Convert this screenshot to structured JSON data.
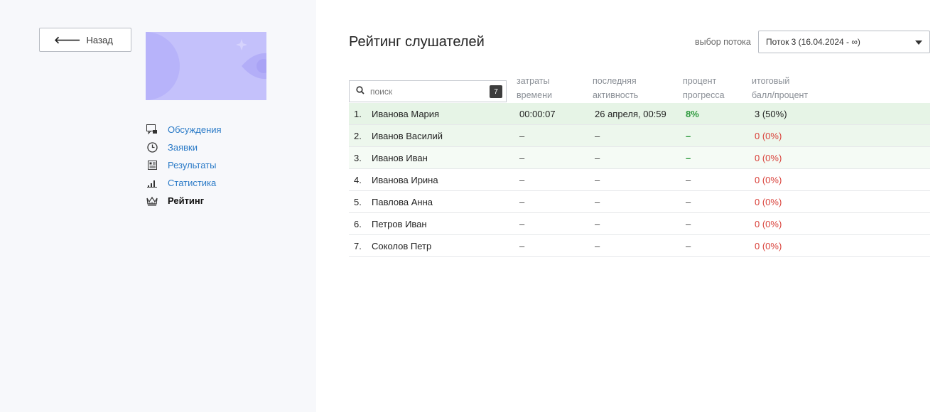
{
  "nav": {
    "back_label": "Назад",
    "items": [
      {
        "label": "Обсуждения",
        "icon": "chat-icon",
        "active": false
      },
      {
        "label": "Заявки",
        "icon": "clock-icon",
        "active": false
      },
      {
        "label": "Результаты",
        "icon": "results-icon",
        "active": false
      },
      {
        "label": "Статистика",
        "icon": "bar-chart-icon",
        "active": false
      },
      {
        "label": "Рейтинг",
        "icon": "crown-icon",
        "active": true
      }
    ]
  },
  "header": {
    "title": "Рейтинг слушателей",
    "stream_label": "выбор потока",
    "stream_selected": "Поток 3 (16.04.2024 - ∞)"
  },
  "search": {
    "placeholder": "поиск",
    "count": "7"
  },
  "columns": {
    "time": [
      "затраты",
      "времени"
    ],
    "activity": [
      "последняя",
      "активность"
    ],
    "progress": [
      "процент",
      "прогресса"
    ],
    "score": [
      "итоговый",
      "балл/процент"
    ]
  },
  "rows": [
    {
      "num": "1.",
      "name": "Иванова Мария",
      "time": "00:00:07",
      "activity": "26 апреля, 00:59",
      "progress": "8%",
      "score": "3 (50%)"
    },
    {
      "num": "2.",
      "name": "Иванов Василий",
      "time": "–",
      "activity": "–",
      "progress": "–",
      "score": "0 (0%)"
    },
    {
      "num": "3.",
      "name": "Иванов Иван",
      "time": "–",
      "activity": "–",
      "progress": "–",
      "score": "0 (0%)"
    },
    {
      "num": "4.",
      "name": "Иванова Ирина",
      "time": "–",
      "activity": "–",
      "progress": "–",
      "score": "0 (0%)"
    },
    {
      "num": "5.",
      "name": "Павлова Анна",
      "time": "–",
      "activity": "–",
      "progress": "–",
      "score": "0 (0%)"
    },
    {
      "num": "6.",
      "name": "Петров Иван",
      "time": "–",
      "activity": "–",
      "progress": "–",
      "score": "0 (0%)"
    },
    {
      "num": "7.",
      "name": "Соколов Петр",
      "time": "–",
      "activity": "–",
      "progress": "–",
      "score": "0 (0%)"
    }
  ],
  "colors": {
    "link": "#2a7ac7",
    "green": "#2e9a3e",
    "red": "#d9413a",
    "row1_bg": "#e6f4e6",
    "row2_bg": "#edf7ed",
    "row3_bg": "#f5fbf5",
    "cover": "#c4c1fb"
  }
}
